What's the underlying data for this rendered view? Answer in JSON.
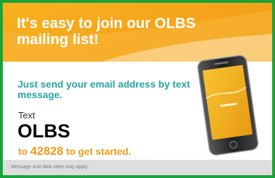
{
  "headline": "It's easy to join our OLBS mailing list!",
  "subhead": "Just send your email address by text message.",
  "text_label": "Text",
  "keyword": "OLBS",
  "cta": {
    "prefix": "to",
    "shortcode": "42828",
    "suffix": "to get started."
  },
  "disclaimer": "Message and data rates may apply",
  "colors": {
    "border": "#1aa33a",
    "hero": "#f4a21a",
    "subhead": "#24a4a7",
    "accent": "#f19a18",
    "disclaimer_bar": "#dedede"
  }
}
